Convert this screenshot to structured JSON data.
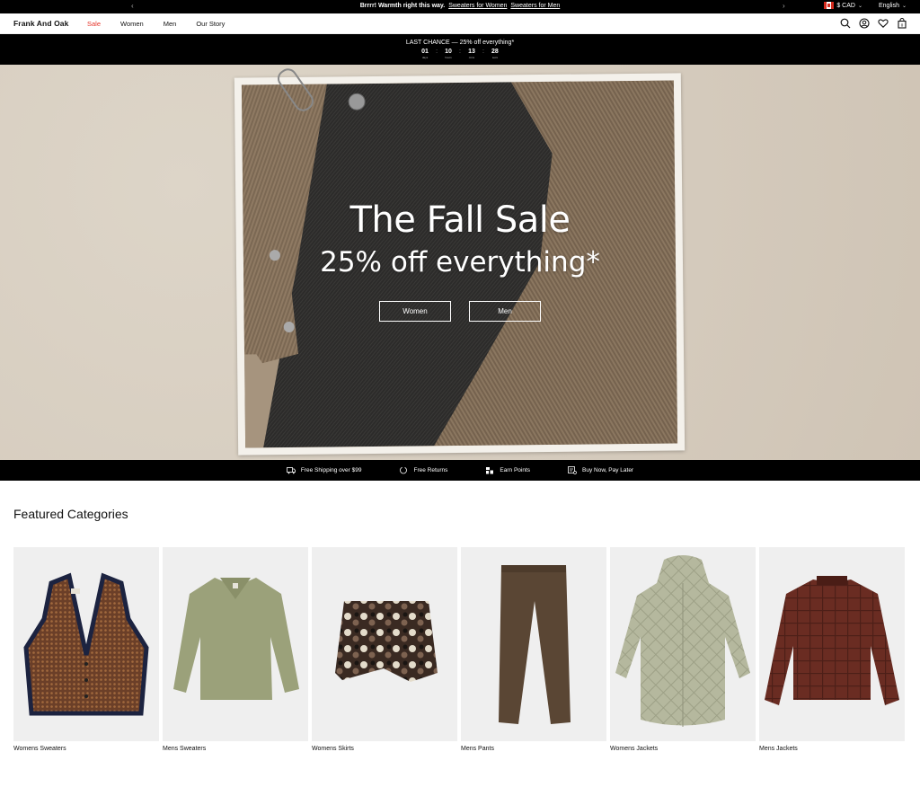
{
  "announcement": {
    "prefix": "Brrrr! Warmth right this way.",
    "link_women": "Sweaters for Women",
    "link_men": "Sweaters for Men",
    "currency": "$ CAD",
    "language": "English"
  },
  "header": {
    "logo": "Frank And Oak",
    "nav": [
      "Sale",
      "Women",
      "Men",
      "Our Story"
    ],
    "cart_count": "0"
  },
  "countdown": {
    "title": "LAST CHANCE — 25% off everything*",
    "units": [
      {
        "value": "01",
        "label": "days"
      },
      {
        "value": "10",
        "label": "hours"
      },
      {
        "value": "13",
        "label": "mins"
      },
      {
        "value": "28",
        "label": "secs"
      }
    ]
  },
  "hero": {
    "title": "The Fall Sale",
    "subtitle": "25% off everything*",
    "buttons": [
      "Women",
      "Men"
    ]
  },
  "perks": [
    "Free Shipping over $99",
    "Free Returns",
    "Earn Points",
    "Buy Now, Pay Later"
  ],
  "featured": {
    "title": "Featured Categories",
    "categories": [
      "Womens Sweaters",
      "Mens Sweaters",
      "Womens Skirts",
      "Mens Pants",
      "Womens Jackets",
      "Mens Jackets"
    ]
  },
  "colors": {
    "sale": "#e5352b",
    "black": "#000000",
    "hero_bg": "#d8cfc1"
  }
}
